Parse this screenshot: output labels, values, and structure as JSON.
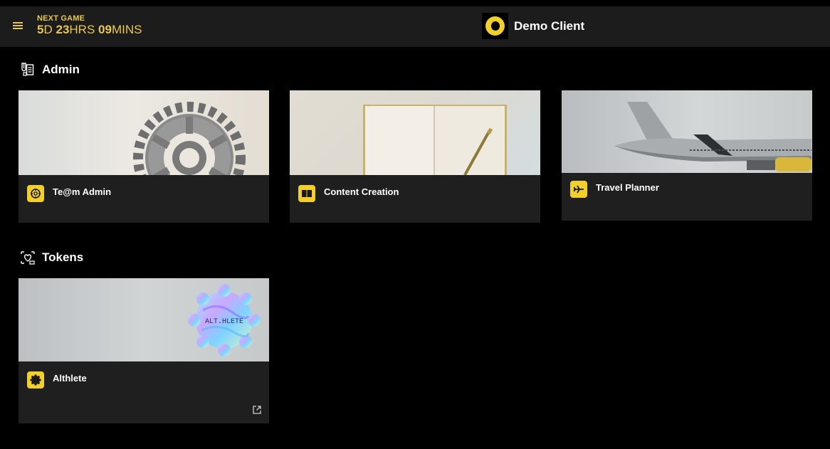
{
  "header": {
    "next_game_label": "NEXT GAME",
    "countdown": {
      "days": "5",
      "days_unit": "D",
      "hours": "23",
      "hours_unit": "HRS",
      "mins": "09",
      "mins_unit": "MINS"
    },
    "client_name": "Demo Client",
    "menu_icon": "hamburger-icon"
  },
  "sections": {
    "admin": {
      "title": "Admin",
      "icon": "admin-document-icon",
      "cards": [
        {
          "title": "Te@m Admin",
          "icon": "target-icon"
        },
        {
          "title": "Content Creation",
          "icon": "book-icon"
        },
        {
          "title": "Travel Planner",
          "icon": "airplane-icon"
        }
      ]
    },
    "tokens": {
      "title": "Tokens",
      "icon": "tokens-icon",
      "cards": [
        {
          "title": "Althlete",
          "icon": "badge-icon",
          "thumb_text": "ALT.HLETE",
          "link_icon": "external-link-icon"
        }
      ]
    }
  },
  "colors": {
    "accent": "#f2cf2b",
    "background": "#000000",
    "card": "#1f1f1f",
    "topbar": "#1c1c1c"
  }
}
